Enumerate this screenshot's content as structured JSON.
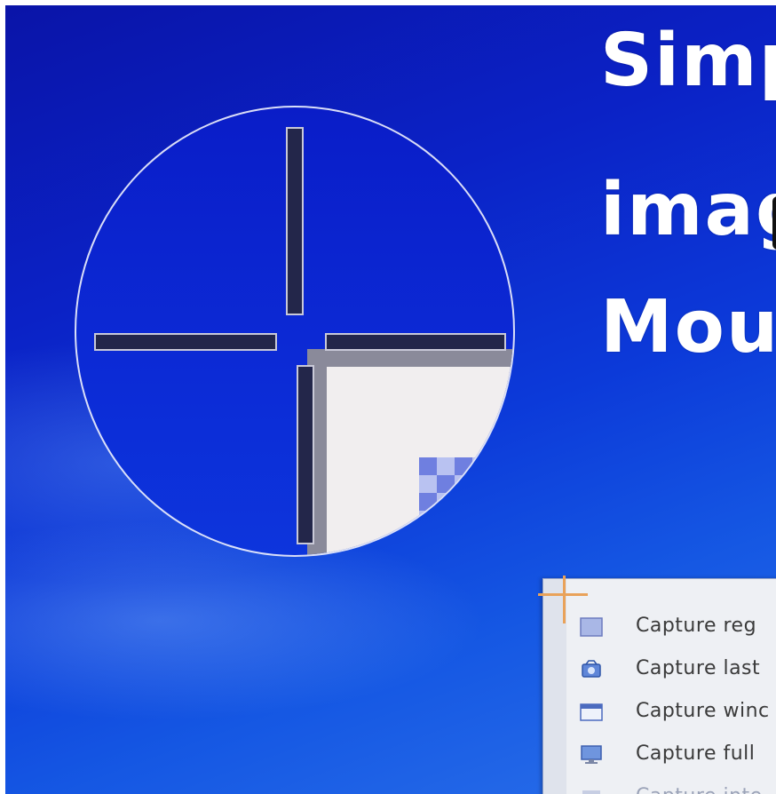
{
  "title": {
    "line1": "Simp",
    "line2": "imag",
    "line3": "Mous"
  },
  "menu": {
    "items": [
      {
        "label": "Capture reg",
        "icon": "region-capture-icon"
      },
      {
        "label": "Capture last",
        "icon": "repeat-capture-icon"
      },
      {
        "label": "Capture winc",
        "icon": "window-capture-icon"
      },
      {
        "label": "Capture full",
        "icon": "fullscreen-capture-icon"
      },
      {
        "label": "Capture inte",
        "icon": "interactive-capture-icon"
      }
    ]
  },
  "colors": {
    "desktop_blue": "#0c2bd6",
    "crosshair_dark": "#23264a",
    "cursor_orange": "#e9a25a",
    "menu_bg": "#eef0f4"
  }
}
